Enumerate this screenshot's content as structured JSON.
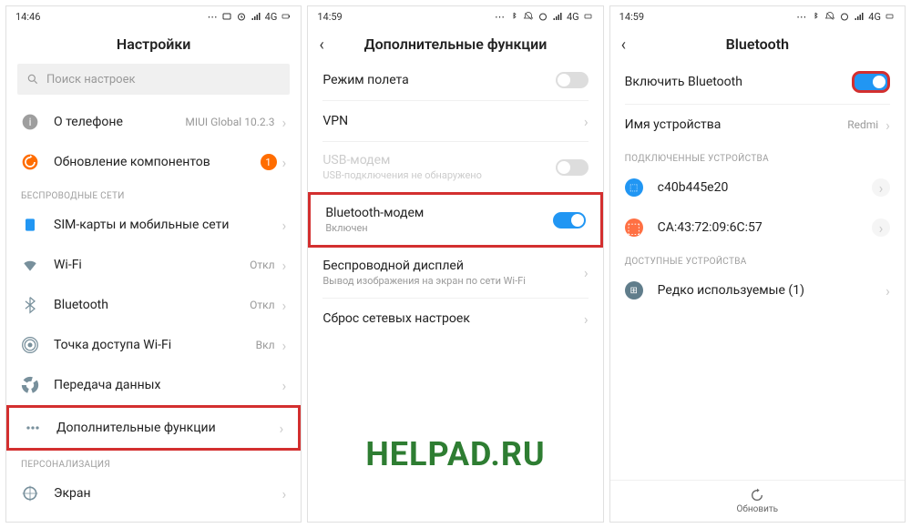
{
  "watermark": "HELPAD.RU",
  "screen1": {
    "time": "14:46",
    "status": "4G",
    "title": "Настройки",
    "searchPlaceholder": "Поиск настроек",
    "items": {
      "about": {
        "label": "О телефоне",
        "value": "MIUI Global 10.2.3"
      },
      "update": {
        "label": "Обновление компонентов",
        "badge": "1"
      }
    },
    "section1": "БЕСПРОВОДНЫЕ СЕТИ",
    "wireless": {
      "sim": "SIM-карты и мобильные сети",
      "wifi": {
        "label": "Wi-Fi",
        "value": "Откл"
      },
      "bt": {
        "label": "Bluetooth",
        "value": "Откл"
      },
      "hotspot": {
        "label": "Точка доступа Wi-Fi",
        "value": "Вкл"
      },
      "data": "Передача данных",
      "more": "Дополнительные функции"
    },
    "section2": "ПЕРСОНАЛИЗАЦИЯ",
    "display": "Экран"
  },
  "screen2": {
    "time": "14:59",
    "status": "4G",
    "title": "Дополнительные функции",
    "items": {
      "airplane": "Режим полета",
      "vpn": "VPN",
      "usb": {
        "label": "USB-модем",
        "subtitle": "USB-подключения не обнаружено"
      },
      "btModem": {
        "label": "Bluetooth-модем",
        "subtitle": "Включен"
      },
      "cast": {
        "label": "Беспроводной дисплей",
        "subtitle": "Вывод изображения на экран по сети Wi-Fi"
      },
      "reset": "Сброс сетевых настроек"
    }
  },
  "screen3": {
    "time": "14:59",
    "status": "4G",
    "title": "Bluetooth",
    "enable": "Включить Bluetooth",
    "devName": {
      "label": "Имя устройства",
      "value": "Redmi"
    },
    "section1": "ПОДКЛЮЧЕННЫЕ УСТРОЙСТВА",
    "dev1": "c40b445e20",
    "dev2": "CA:43:72:09:6C:57",
    "section2": "ДОСТУПНЫЕ УСТРОЙСТВА",
    "rare": "Редко используемые (1)",
    "refresh": "Обновить"
  }
}
